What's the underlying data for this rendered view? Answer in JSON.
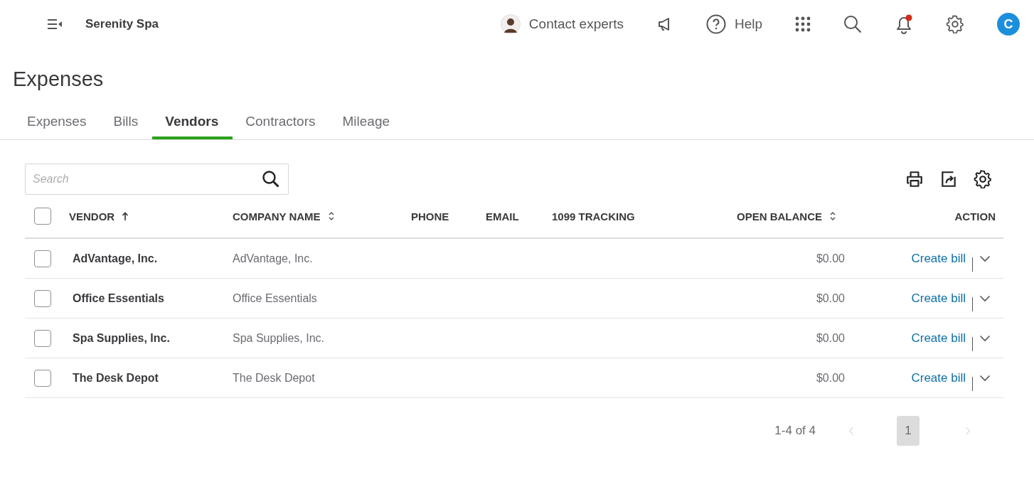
{
  "topbar": {
    "company": "Serenity Spa",
    "contact": "Contact experts",
    "help": "Help",
    "notifications_unread": true,
    "user_initial": "C"
  },
  "page_title": "Expenses",
  "tabs": [
    {
      "label": "Expenses",
      "selected": false
    },
    {
      "label": "Bills",
      "selected": false
    },
    {
      "label": "Vendors",
      "selected": true
    },
    {
      "label": "Contractors",
      "selected": false
    },
    {
      "label": "Mileage",
      "selected": false
    }
  ],
  "search": {
    "placeholder": "Search"
  },
  "table": {
    "columns": [
      {
        "label": "VENDOR",
        "kind": "sorted"
      },
      {
        "label": "COMPANY NAME",
        "kind": "sortable"
      },
      {
        "label": "PHONE",
        "kind": "plain"
      },
      {
        "label": "EMAIL",
        "kind": "plain"
      },
      {
        "label": "1099 TRACKING",
        "kind": "plain"
      },
      {
        "label": "OPEN BALANCE",
        "kind": "sortable"
      },
      {
        "label": "ACTION",
        "kind": "plain"
      }
    ],
    "all_checked": false,
    "rows": [
      {
        "checked": false,
        "vendor": "AdVantage, Inc.",
        "company": "AdVantage, Inc.",
        "balance": "$0.00",
        "action": "Create bill"
      },
      {
        "checked": false,
        "vendor": "Office Essentials",
        "company": "Office Essentials",
        "balance": "$0.00",
        "action": "Create bill"
      },
      {
        "checked": false,
        "vendor": "Spa Supplies, Inc.",
        "company": "Spa Supplies, Inc.",
        "balance": "$0.00",
        "action": "Create bill"
      },
      {
        "checked": false,
        "vendor": "The Desk Depot",
        "company": "The Desk Depot",
        "balance": "$0.00",
        "action": "Create bill"
      }
    ]
  },
  "pagination": {
    "range": "1-4 of 4",
    "previous_disabled": true,
    "next_disabled": true,
    "pages": [
      {
        "label": "1",
        "selected": true
      }
    ]
  }
}
